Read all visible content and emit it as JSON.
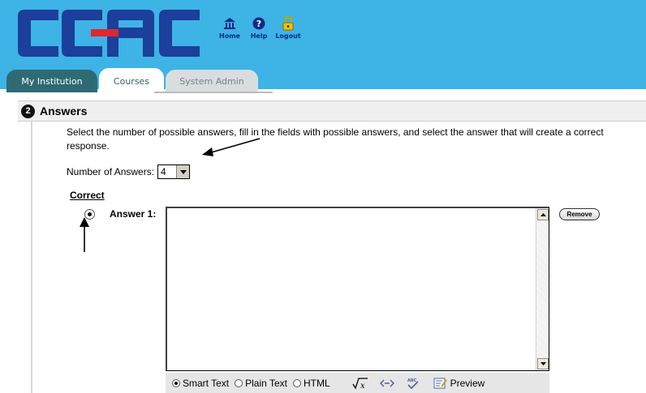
{
  "header": {
    "logo_text": "CCAC",
    "nav": [
      {
        "label": "Home",
        "icon": "home-icon"
      },
      {
        "label": "Help",
        "icon": "help-icon"
      },
      {
        "label": "Logout",
        "icon": "lock-icon"
      }
    ],
    "colors": {
      "banner": "#3db3e6",
      "logo_blue": "#1b3f9a",
      "logo_red": "#e1262d"
    }
  },
  "tabs": [
    {
      "label": "My Institution",
      "state": "inactive-dark"
    },
    {
      "label": "Courses",
      "state": "active"
    },
    {
      "label": "System Admin",
      "state": "inactive"
    }
  ],
  "section": {
    "step": "2",
    "title": "Answers"
  },
  "main": {
    "instructions": "Select the number of possible answers, fill in the fields with possible answers, and select the answer that will create a correct response.",
    "num_answers_label": "Number of Answers:",
    "num_answers_value": "4",
    "correct_label": "Correct",
    "answers": [
      {
        "label": "Answer 1:",
        "text": "",
        "correct": true,
        "remove_label": "Remove"
      }
    ],
    "editor_modes": [
      {
        "label": "Smart Text",
        "selected": true
      },
      {
        "label": "Plain Text",
        "selected": false
      },
      {
        "label": "HTML",
        "selected": false
      }
    ],
    "preview_label": "Preview"
  }
}
